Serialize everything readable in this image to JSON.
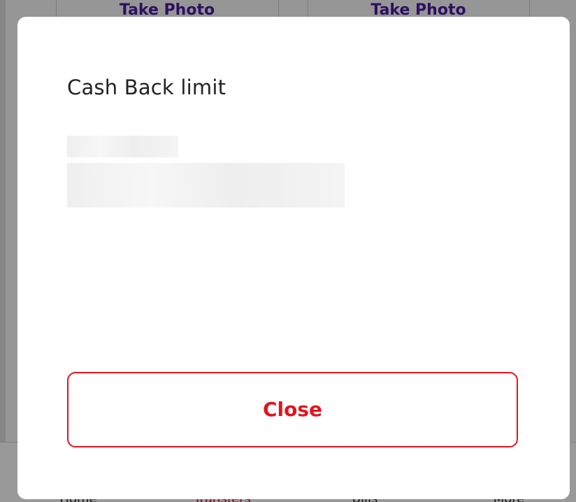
{
  "background": {
    "take_photo_left": "Take Photo",
    "take_photo_right": "Take Photo",
    "tabs": [
      {
        "label": "Home"
      },
      {
        "label": "Transfers"
      },
      {
        "label": "Bills"
      },
      {
        "label": "More"
      }
    ],
    "active_tab": "Transfers"
  },
  "modal": {
    "title": "Cash Back limit",
    "close_label": "Close"
  },
  "colors": {
    "accent_red": "#e2141c",
    "link_purple": "#4a1a9e"
  }
}
